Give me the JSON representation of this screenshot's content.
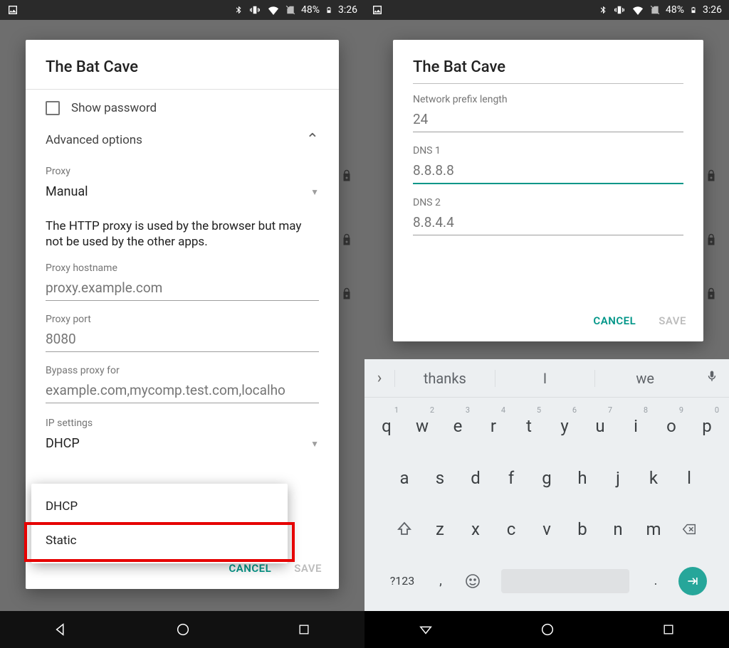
{
  "status": {
    "battery_pct": "48%",
    "time": "3:26"
  },
  "left": {
    "title": "The Bat Cave",
    "show_password_label": "Show password",
    "advanced_label": "Advanced options",
    "proxy_label": "Proxy",
    "proxy_value": "Manual",
    "proxy_help": "The HTTP proxy is used by the browser but may not be used by the other apps.",
    "hostname_label": "Proxy hostname",
    "hostname_placeholder": "proxy.example.com",
    "port_label": "Proxy port",
    "port_placeholder": "8080",
    "bypass_label": "Bypass proxy for",
    "bypass_placeholder": "example.com,mycomp.test.com,localho",
    "ip_label": "IP settings",
    "ip_value": "DHCP",
    "dropdown": {
      "dhcp": "DHCP",
      "static": "Static"
    },
    "cancel": "CANCEL",
    "save": "SAVE"
  },
  "right": {
    "title": "The Bat Cave",
    "prefix_label": "Network prefix length",
    "prefix_value": "24",
    "dns1_label": "DNS 1",
    "dns1_value": "8.8.8.8",
    "dns2_label": "DNS 2",
    "dns2_value": "8.8.4.4",
    "cancel": "CANCEL",
    "save": "SAVE"
  },
  "keyboard": {
    "sugg1": "thanks",
    "sugg2": "I",
    "sugg3": "we",
    "row1": [
      "q",
      "w",
      "e",
      "r",
      "t",
      "y",
      "u",
      "i",
      "o",
      "p"
    ],
    "row1sup": [
      "1",
      "2",
      "3",
      "4",
      "5",
      "6",
      "7",
      "8",
      "9",
      "0"
    ],
    "row2": [
      "a",
      "s",
      "d",
      "f",
      "g",
      "h",
      "j",
      "k",
      "l"
    ],
    "row3": [
      "z",
      "x",
      "c",
      "v",
      "b",
      "n",
      "m"
    ],
    "sym": "?123",
    "comma": ",",
    "period": "."
  }
}
